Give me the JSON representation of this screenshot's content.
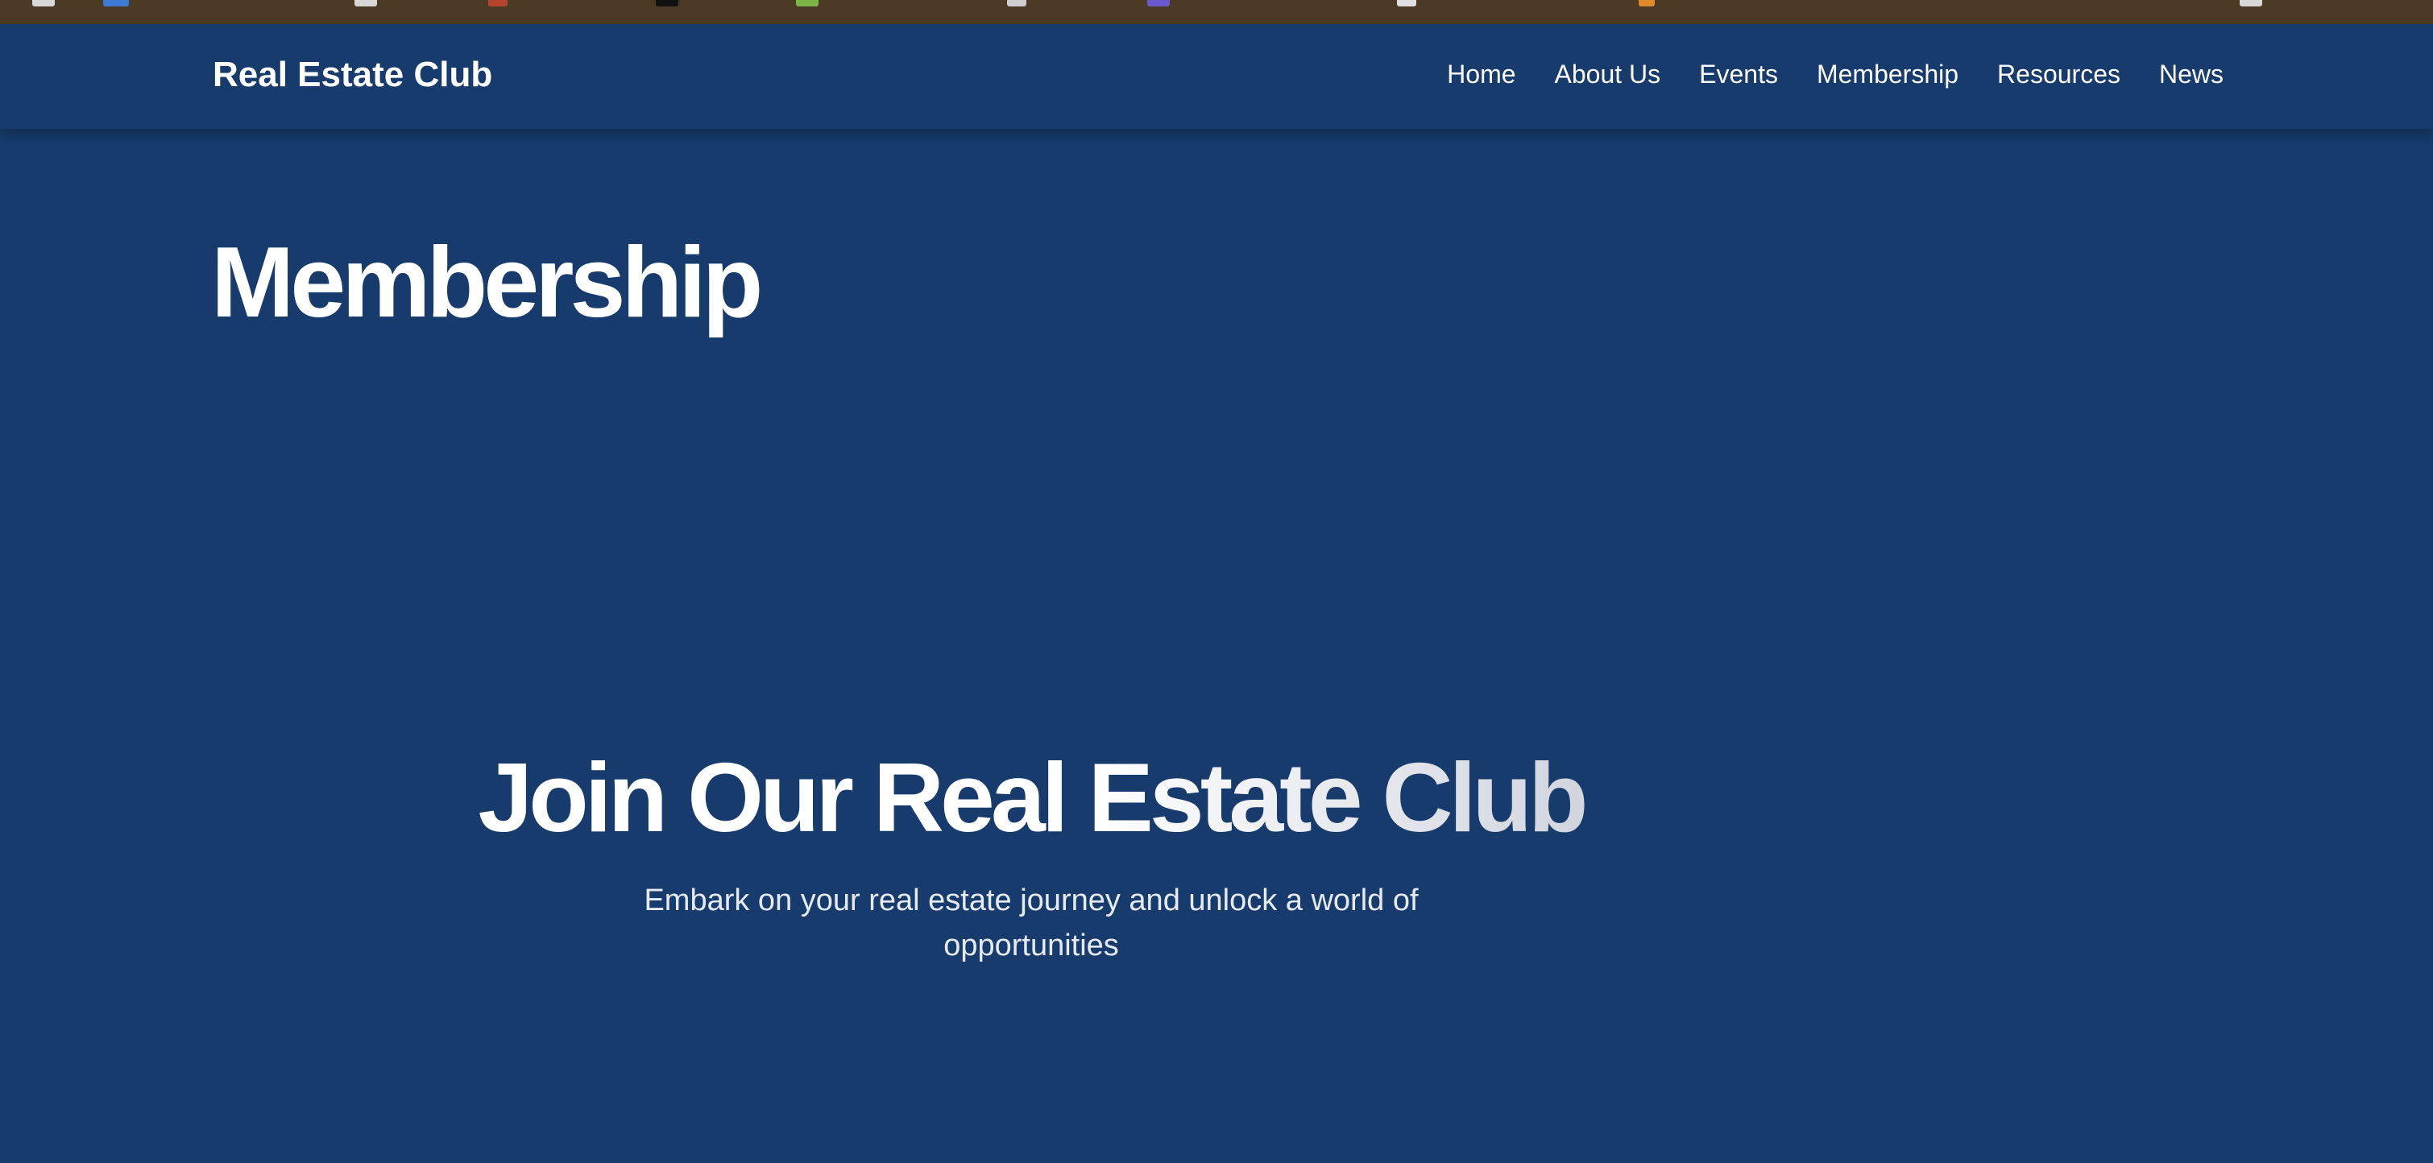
{
  "colors": {
    "page_background": "#173b6c",
    "browser_strip": "#4a3a24",
    "text": "#ffffff"
  },
  "header": {
    "brand": "Real Estate Club",
    "nav": [
      {
        "label": "Home"
      },
      {
        "label": "About Us"
      },
      {
        "label": "Events"
      },
      {
        "label": "Membership"
      },
      {
        "label": "Resources"
      },
      {
        "label": "News"
      }
    ]
  },
  "page": {
    "title": "Membership"
  },
  "hero": {
    "title": "Join Our Real Estate Club",
    "subtitle": "Embark on your real estate journey and unlock a world of opportunities"
  }
}
